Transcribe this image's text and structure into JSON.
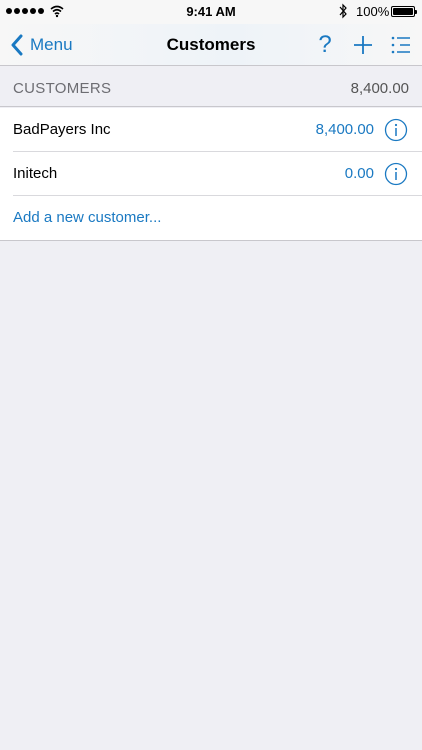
{
  "status_bar": {
    "time": "9:41 AM",
    "battery": "100%"
  },
  "nav": {
    "back_label": "Menu",
    "title": "Customers",
    "help_glyph": "?"
  },
  "section": {
    "title": "CUSTOMERS",
    "total": "8,400.00"
  },
  "customers": [
    {
      "name": "BadPayers Inc",
      "amount": "8,400.00"
    },
    {
      "name": "Initech",
      "amount": "0.00"
    }
  ],
  "add_label": "Add a new customer...",
  "icons": {
    "back": "chevron-left-icon",
    "help": "help-icon",
    "add": "plus-icon",
    "menu": "list-icon",
    "info": "info-icon"
  },
  "colors": {
    "accent": "#1a79c2",
    "background": "#efeff4"
  }
}
